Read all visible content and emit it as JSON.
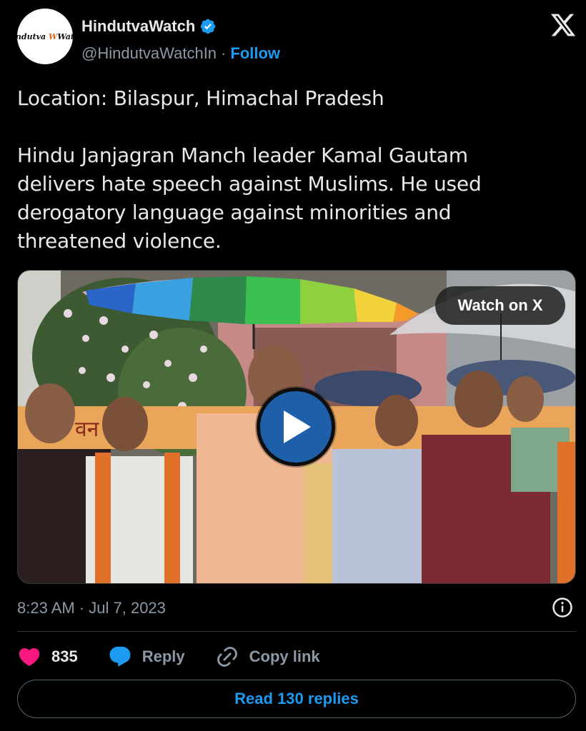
{
  "account": {
    "avatar_text_left": "Hindutva",
    "avatar_text_right": "Watch",
    "name": "HindutvaWatch",
    "handle": "@HindutvaWatchIn",
    "separator": "·",
    "follow_label": "Follow",
    "verified": true
  },
  "tweet": {
    "location_line": "Location: Bilaspur, Himachal Pradesh",
    "body_lines": [
      "Hindu Janjagran Manch leader Kamal Gautam",
      "delivers hate speech against Muslims. He used",
      "derogatory language against minorities and",
      "threatened violence."
    ],
    "timestamp": "8:23 AM · Jul 7, 2023"
  },
  "media": {
    "watch_label": "Watch on X",
    "banner_text": "वन हत्या"
  },
  "actions": {
    "like_count": "835",
    "reply_label": "Reply",
    "copy_label": "Copy link"
  },
  "read_replies_label": "Read 130 replies",
  "colors": {
    "background": "#000000",
    "text": "#e7e9ea",
    "secondary": "#8b98a5",
    "link_blue": "#1d9bf0",
    "like_pink": "#f91880",
    "play_blue": "#1d5fa8"
  },
  "icons": [
    "verified-badge-icon",
    "x-logo-icon",
    "play-icon",
    "info-icon",
    "heart-icon",
    "reply-bubble-icon",
    "link-icon"
  ]
}
